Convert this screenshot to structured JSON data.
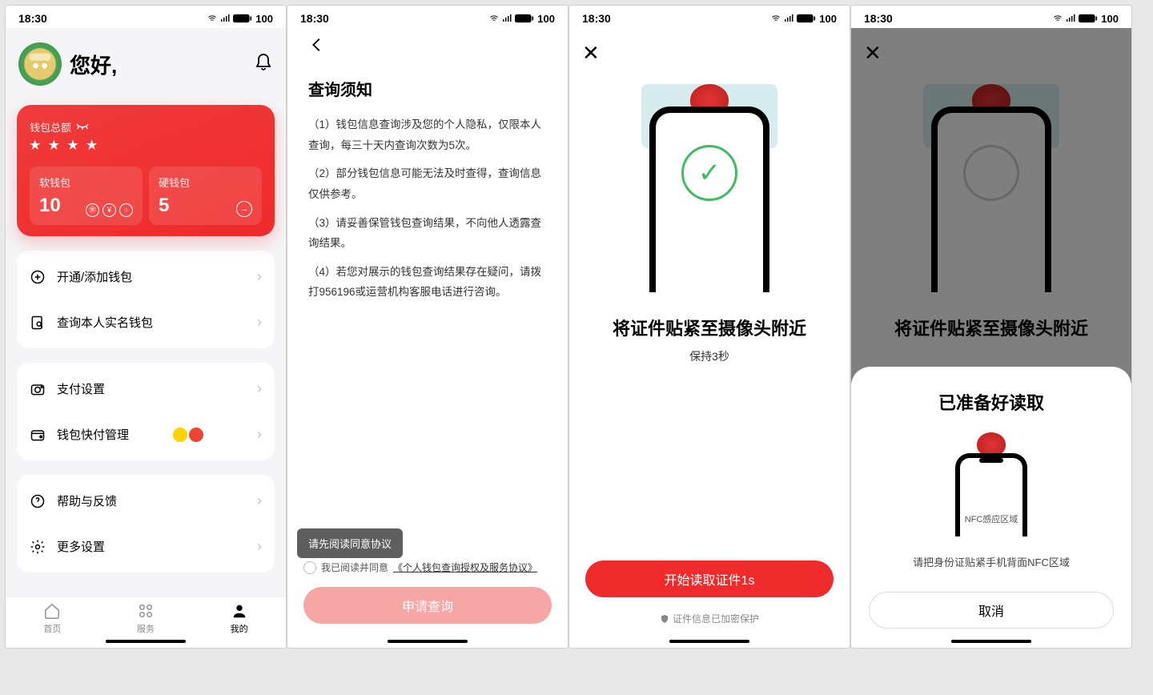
{
  "status": {
    "time": "18:30",
    "battery": "100"
  },
  "screen1": {
    "greeting": "您好,",
    "wallet": {
      "total_label": "钱包总额",
      "stars": "★ ★ ★ ★",
      "soft": {
        "label": "软钱包",
        "count": "10"
      },
      "hard": {
        "label": "硬钱包",
        "count": "5"
      }
    },
    "menu_group1": [
      {
        "icon": "plus",
        "label": "开通/添加钱包"
      },
      {
        "icon": "search",
        "label": "查询本人实名钱包"
      }
    ],
    "menu_group2": [
      {
        "icon": "pay",
        "label": "支付设置"
      },
      {
        "icon": "wallet",
        "label": "钱包快付管理",
        "badges": true
      }
    ],
    "menu_group3": [
      {
        "icon": "help",
        "label": "帮助与反馈"
      },
      {
        "icon": "gear",
        "label": "更多设置"
      }
    ],
    "nav": {
      "home": "首页",
      "service": "服务",
      "mine": "我的"
    }
  },
  "screen2": {
    "title": "查询须知",
    "p1": "（1）钱包信息查询涉及您的个人隐私，仅限本人查询，每三十天内查询次数为5次。",
    "p2": "（2）部分钱包信息可能无法及时查得，查询信息仅供参考。",
    "p3": "（3）请妥善保管钱包查询结果，不向他人透露查询结果。",
    "p4": "（4）若您对展示的钱包查询结果存在疑问，请拨打956196或运营机构客服电话进行咨询。",
    "tooltip": "请先阅读同意协议",
    "agree_prefix": "我已阅读并同意",
    "agree_link": "《个人钱包查询授权及服务协议》",
    "button": "申请查询"
  },
  "screen3": {
    "title": "将证件贴紧至摄像头附近",
    "sub": "保持3秒",
    "button": "开始读取证件1s",
    "note": "证件信息已加密保护"
  },
  "screen4": {
    "title": "已准备好读取",
    "nfc_label": "NFC感应区域",
    "sub": "请把身份证贴紧手机背面NFC区域",
    "cancel": "取消",
    "back_title": "将证件贴紧至摄像头附近"
  }
}
